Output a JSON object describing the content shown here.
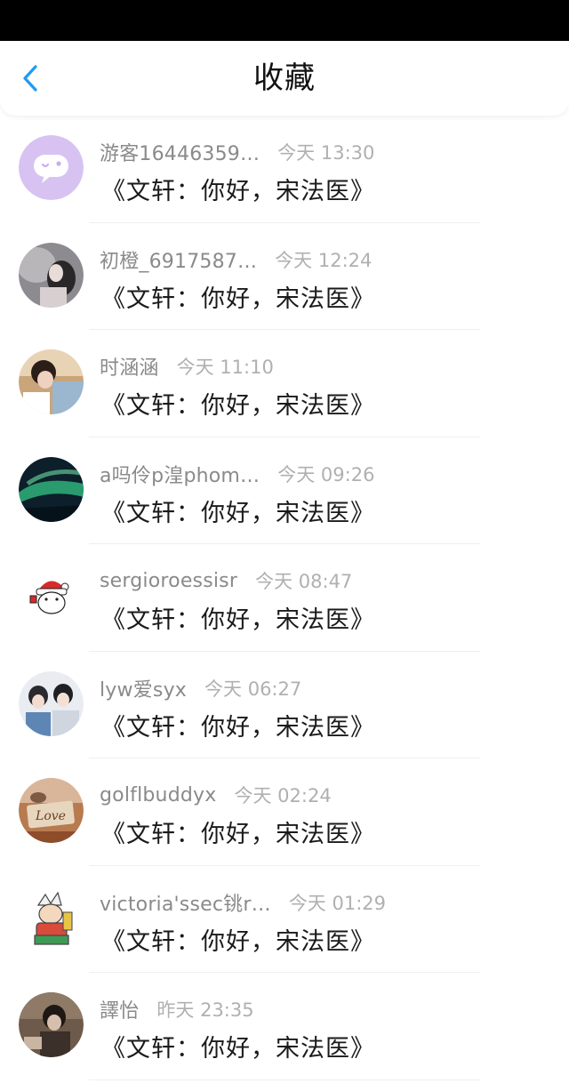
{
  "header": {
    "title": "收藏",
    "back_icon": "chevron-left-icon",
    "accent_color": "#1e9af3"
  },
  "items": [
    {
      "user": "游客16446359…",
      "time": "今天 13:30",
      "title": "《文轩：你好，宋法医》",
      "avatar": "chat-bubble-icon"
    },
    {
      "user": "初橙_6917587…",
      "time": "今天 12:24",
      "title": "《文轩：你好，宋法医》",
      "avatar": "photo-avatar"
    },
    {
      "user": "时涵涵",
      "time": "今天 11:10",
      "title": "《文轩：你好，宋法医》",
      "avatar": "photo-avatar"
    },
    {
      "user": "a吗伶p湟phom…",
      "time": "今天 09:26",
      "title": "《文轩：你好，宋法医》",
      "avatar": "photo-avatar"
    },
    {
      "user": "sergioroessisr",
      "time": "今天 08:47",
      "title": "《文轩：你好，宋法医》",
      "avatar": "santa-avatar"
    },
    {
      "user": "lyw爱syx",
      "time": "今天 06:27",
      "title": "《文轩：你好，宋法医》",
      "avatar": "photo-avatar"
    },
    {
      "user": "golflbuddyx",
      "time": "今天 02:24",
      "title": "《文轩：你好，宋法医》",
      "avatar": "photo-avatar"
    },
    {
      "user": "victoria'ssec铫r…",
      "time": "今天 01:29",
      "title": "《文轩：你好，宋法医》",
      "avatar": "cartoon-avatar"
    },
    {
      "user": "譯怡",
      "time": "昨天 23:35",
      "title": "《文轩：你好，宋法医》",
      "avatar": "photo-avatar"
    }
  ]
}
